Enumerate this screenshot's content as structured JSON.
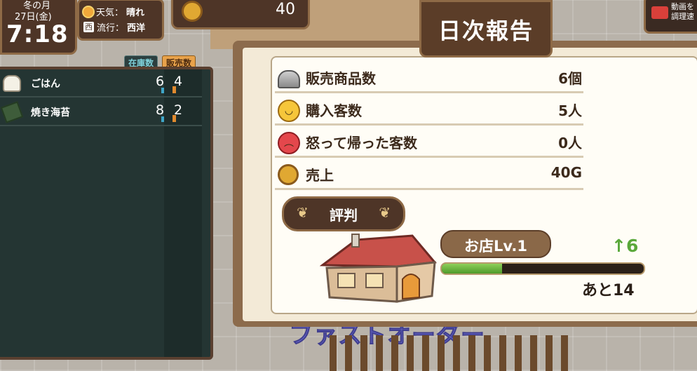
{
  "hud": {
    "month": "冬の月",
    "date": "27日(金)",
    "time": "7:18",
    "weather_label": "天気：",
    "weather_value": "晴れ",
    "trend_badge": "西",
    "trend_label": "流行：",
    "trend_value": "西洋",
    "money": "40",
    "video_text_1": "動画を",
    "video_text_2": "調理速"
  },
  "background": {
    "category_text": "ファストオーダー"
  },
  "inventory": {
    "stock_header": "在庫数",
    "sold_header": "販売数",
    "items": [
      {
        "name": "ごはん",
        "stock": "6",
        "sold": "4",
        "icon": "rice-bowl-icon"
      },
      {
        "name": "焼き海苔",
        "stock": "8",
        "sold": "2",
        "icon": "seaweed-icon"
      }
    ]
  },
  "report": {
    "title": "日次報告",
    "stats": [
      {
        "label": "販売商品数",
        "value": "6個",
        "icon": "cloche-icon"
      },
      {
        "label": "購入客数",
        "value": "5人",
        "icon": "smile-face-icon"
      },
      {
        "label": "怒って帰った客数",
        "value": "0人",
        "icon": "angry-face-icon"
      },
      {
        "label": "売上",
        "value": "40G",
        "icon": "coin-icon"
      }
    ],
    "reputation_label": "評判",
    "shop_level": "お店Lv.1",
    "level_gain": "↑6",
    "remaining": "あと14",
    "xp_progress": 0.3,
    "colors": {
      "xp_fill": "#6fbf3f",
      "accent": "#5b3d28"
    }
  }
}
